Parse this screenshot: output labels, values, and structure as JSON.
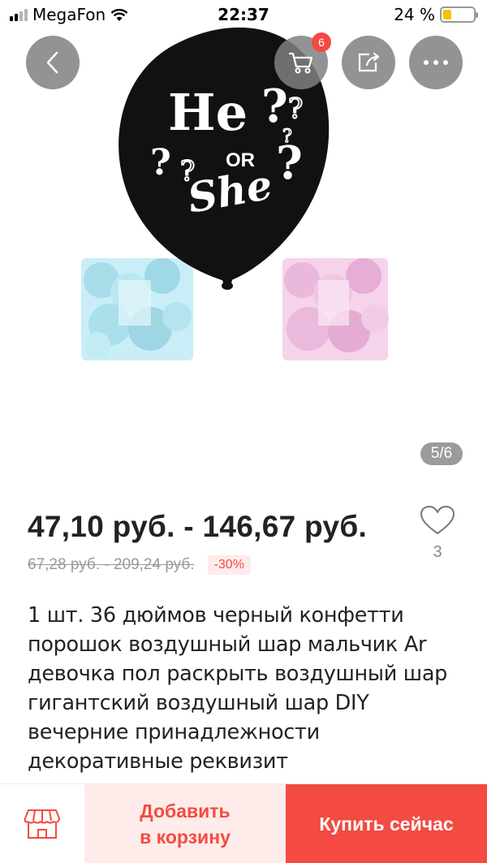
{
  "status": {
    "carrier": "MegaFon",
    "time": "22:37",
    "battery": "24 %"
  },
  "gallery": {
    "page_indicator": "5/6",
    "cart_badge": "6",
    "balloon_text": {
      "he": "He",
      "or": "OR",
      "she": "She"
    }
  },
  "price": {
    "range": "47,10 руб. - 146,67 руб.",
    "old_range": "67,28 руб. - 209,24 руб.",
    "discount": "-30%"
  },
  "wishlist": {
    "count": "3"
  },
  "product": {
    "title": "1 шт. 36 дюймов черный конфетти порошок воздушный шар мальчик Ar девочка пол раскрыть воздушный шар гигантский воздушный шар DIY вечерние принадлежности декоративные реквизит"
  },
  "actions": {
    "add_to_cart_line1": "Добавить",
    "add_to_cart_line2": "в корзину",
    "buy_now": "Купить сейчас"
  },
  "colors": {
    "accent": "#f34b41",
    "accent_light": "#fdecea",
    "button_overlay": "#808080"
  }
}
